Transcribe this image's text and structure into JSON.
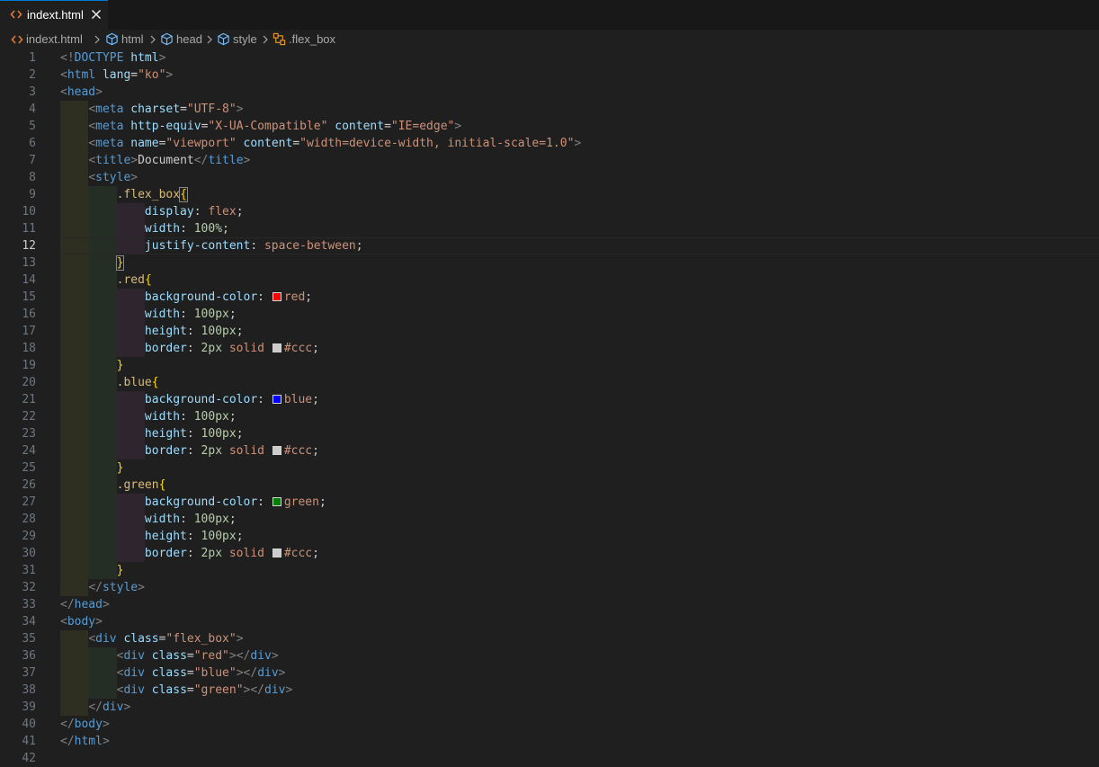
{
  "tab": {
    "label": "indext.html",
    "icon": "html-file-icon",
    "close_icon": "close-icon"
  },
  "breadcrumb": [
    {
      "label": "indext.html",
      "icon": "html-file-icon"
    },
    {
      "label": "html",
      "icon": "symbol-element-icon"
    },
    {
      "label": "head",
      "icon": "symbol-element-icon"
    },
    {
      "label": "style",
      "icon": "symbol-element-icon"
    },
    {
      "label": ".flex_box",
      "icon": "symbol-class-icon"
    }
  ],
  "editor": {
    "active_line": 12,
    "lines": [
      {
        "n": "1",
        "tokens": [
          [
            "t-br",
            "<!"
          ],
          [
            "t-doctype",
            "DOCTYPE"
          ],
          [
            "t-txt",
            " "
          ],
          [
            "t-kw",
            "html"
          ],
          [
            "t-br",
            ">"
          ]
        ]
      },
      {
        "n": "2",
        "tokens": [
          [
            "t-br",
            "<"
          ],
          [
            "t-tag",
            "html"
          ],
          [
            "t-txt",
            " "
          ],
          [
            "t-attr",
            "lang"
          ],
          [
            "t-txt",
            "="
          ],
          [
            "t-str",
            "\"ko\""
          ],
          [
            "t-br",
            ">"
          ]
        ]
      },
      {
        "n": "3",
        "tokens": [
          [
            "t-br",
            "<"
          ],
          [
            "t-tag",
            "head"
          ],
          [
            "t-br",
            ">"
          ]
        ]
      },
      {
        "n": "4",
        "tokens": [
          [
            "t-txt",
            "    "
          ],
          [
            "t-br",
            "<"
          ],
          [
            "t-tag",
            "meta"
          ],
          [
            "t-txt",
            " "
          ],
          [
            "t-attr",
            "charset"
          ],
          [
            "t-txt",
            "="
          ],
          [
            "t-str",
            "\"UTF-8\""
          ],
          [
            "t-br",
            ">"
          ]
        ]
      },
      {
        "n": "5",
        "tokens": [
          [
            "t-txt",
            "    "
          ],
          [
            "t-br",
            "<"
          ],
          [
            "t-tag",
            "meta"
          ],
          [
            "t-txt",
            " "
          ],
          [
            "t-attr",
            "http-equiv"
          ],
          [
            "t-txt",
            "="
          ],
          [
            "t-str",
            "\"X-UA-Compatible\""
          ],
          [
            "t-txt",
            " "
          ],
          [
            "t-attr",
            "content"
          ],
          [
            "t-txt",
            "="
          ],
          [
            "t-str",
            "\"IE=edge\""
          ],
          [
            "t-br",
            ">"
          ]
        ]
      },
      {
        "n": "6",
        "tokens": [
          [
            "t-txt",
            "    "
          ],
          [
            "t-br",
            "<"
          ],
          [
            "t-tag",
            "meta"
          ],
          [
            "t-txt",
            " "
          ],
          [
            "t-attr",
            "name"
          ],
          [
            "t-txt",
            "="
          ],
          [
            "t-str",
            "\"viewport\""
          ],
          [
            "t-txt",
            " "
          ],
          [
            "t-attr",
            "content"
          ],
          [
            "t-txt",
            "="
          ],
          [
            "t-str",
            "\"width=device-width, initial-scale=1.0\""
          ],
          [
            "t-br",
            ">"
          ]
        ]
      },
      {
        "n": "7",
        "tokens": [
          [
            "t-txt",
            "    "
          ],
          [
            "t-br",
            "<"
          ],
          [
            "t-tag",
            "title"
          ],
          [
            "t-br",
            ">"
          ],
          [
            "t-txt",
            "Document"
          ],
          [
            "t-br",
            "</"
          ],
          [
            "t-tag",
            "title"
          ],
          [
            "t-br",
            ">"
          ]
        ]
      },
      {
        "n": "8",
        "tokens": [
          [
            "t-txt",
            "    "
          ],
          [
            "t-br",
            "<"
          ],
          [
            "t-tag",
            "style"
          ],
          [
            "t-br",
            ">"
          ]
        ]
      },
      {
        "n": "9",
        "tokens": [
          [
            "t-txt",
            "        "
          ],
          [
            "t-sel",
            ".flex_box"
          ],
          [
            "t-brace brace-match",
            "{"
          ]
        ]
      },
      {
        "n": "10",
        "tokens": [
          [
            "t-txt",
            "            "
          ],
          [
            "t-prop",
            "display"
          ],
          [
            "t-punc",
            ": "
          ],
          [
            "t-val",
            "flex"
          ],
          [
            "t-punc",
            ";"
          ]
        ]
      },
      {
        "n": "11",
        "tokens": [
          [
            "t-txt",
            "            "
          ],
          [
            "t-prop",
            "width"
          ],
          [
            "t-punc",
            ": "
          ],
          [
            "t-num",
            "100%"
          ],
          [
            "t-punc",
            ";"
          ]
        ]
      },
      {
        "n": "12",
        "tokens": [
          [
            "t-txt",
            "            "
          ],
          [
            "t-prop",
            "justify-content"
          ],
          [
            "t-punc",
            ": "
          ],
          [
            "t-val",
            "space-between"
          ],
          [
            "t-punc",
            ";"
          ]
        ]
      },
      {
        "n": "13",
        "tokens": [
          [
            "t-txt",
            "        "
          ],
          [
            "t-brace brace-match",
            "}"
          ]
        ]
      },
      {
        "n": "14",
        "tokens": [
          [
            "t-txt",
            "        "
          ],
          [
            "t-sel",
            ".red"
          ],
          [
            "t-brace",
            "{"
          ]
        ]
      },
      {
        "n": "15",
        "tokens": [
          [
            "t-txt",
            "            "
          ],
          [
            "t-prop",
            "background-color"
          ],
          [
            "t-punc",
            ": "
          ],
          [
            "swatch",
            "#ff0000"
          ],
          [
            "t-val",
            "red"
          ],
          [
            "t-punc",
            ";"
          ]
        ]
      },
      {
        "n": "16",
        "tokens": [
          [
            "t-txt",
            "            "
          ],
          [
            "t-prop",
            "width"
          ],
          [
            "t-punc",
            ": "
          ],
          [
            "t-num",
            "100px"
          ],
          [
            "t-punc",
            ";"
          ]
        ]
      },
      {
        "n": "17",
        "tokens": [
          [
            "t-txt",
            "            "
          ],
          [
            "t-prop",
            "height"
          ],
          [
            "t-punc",
            ": "
          ],
          [
            "t-num",
            "100px"
          ],
          [
            "t-punc",
            ";"
          ]
        ]
      },
      {
        "n": "18",
        "tokens": [
          [
            "t-txt",
            "            "
          ],
          [
            "t-prop",
            "border"
          ],
          [
            "t-punc",
            ": "
          ],
          [
            "t-num",
            "2px"
          ],
          [
            "t-txt",
            " "
          ],
          [
            "t-val",
            "solid"
          ],
          [
            "t-txt",
            " "
          ],
          [
            "swatch",
            "#cccccc"
          ],
          [
            "t-val",
            "#ccc"
          ],
          [
            "t-punc",
            ";"
          ]
        ]
      },
      {
        "n": "19",
        "tokens": [
          [
            "t-txt",
            "        "
          ],
          [
            "t-brace",
            "}"
          ]
        ]
      },
      {
        "n": "20",
        "tokens": [
          [
            "t-txt",
            "        "
          ],
          [
            "t-sel",
            ".blue"
          ],
          [
            "t-brace",
            "{"
          ]
        ]
      },
      {
        "n": "21",
        "tokens": [
          [
            "t-txt",
            "            "
          ],
          [
            "t-prop",
            "background-color"
          ],
          [
            "t-punc",
            ": "
          ],
          [
            "swatch",
            "#0000ff"
          ],
          [
            "t-val",
            "blue"
          ],
          [
            "t-punc",
            ";"
          ]
        ]
      },
      {
        "n": "22",
        "tokens": [
          [
            "t-txt",
            "            "
          ],
          [
            "t-prop",
            "width"
          ],
          [
            "t-punc",
            ": "
          ],
          [
            "t-num",
            "100px"
          ],
          [
            "t-punc",
            ";"
          ]
        ]
      },
      {
        "n": "23",
        "tokens": [
          [
            "t-txt",
            "            "
          ],
          [
            "t-prop",
            "height"
          ],
          [
            "t-punc",
            ": "
          ],
          [
            "t-num",
            "100px"
          ],
          [
            "t-punc",
            ";"
          ]
        ]
      },
      {
        "n": "24",
        "tokens": [
          [
            "t-txt",
            "            "
          ],
          [
            "t-prop",
            "border"
          ],
          [
            "t-punc",
            ": "
          ],
          [
            "t-num",
            "2px"
          ],
          [
            "t-txt",
            " "
          ],
          [
            "t-val",
            "solid"
          ],
          [
            "t-txt",
            " "
          ],
          [
            "swatch",
            "#cccccc"
          ],
          [
            "t-val",
            "#ccc"
          ],
          [
            "t-punc",
            ";"
          ]
        ]
      },
      {
        "n": "25",
        "tokens": [
          [
            "t-txt",
            "        "
          ],
          [
            "t-brace",
            "}"
          ]
        ]
      },
      {
        "n": "26",
        "tokens": [
          [
            "t-txt",
            "        "
          ],
          [
            "t-sel",
            ".green"
          ],
          [
            "t-brace",
            "{"
          ]
        ]
      },
      {
        "n": "27",
        "tokens": [
          [
            "t-txt",
            "            "
          ],
          [
            "t-prop",
            "background-color"
          ],
          [
            "t-punc",
            ": "
          ],
          [
            "swatch",
            "#008000"
          ],
          [
            "t-val",
            "green"
          ],
          [
            "t-punc",
            ";"
          ]
        ]
      },
      {
        "n": "28",
        "tokens": [
          [
            "t-txt",
            "            "
          ],
          [
            "t-prop",
            "width"
          ],
          [
            "t-punc",
            ": "
          ],
          [
            "t-num",
            "100px"
          ],
          [
            "t-punc",
            ";"
          ]
        ]
      },
      {
        "n": "29",
        "tokens": [
          [
            "t-txt",
            "            "
          ],
          [
            "t-prop",
            "height"
          ],
          [
            "t-punc",
            ": "
          ],
          [
            "t-num",
            "100px"
          ],
          [
            "t-punc",
            ";"
          ]
        ]
      },
      {
        "n": "30",
        "tokens": [
          [
            "t-txt",
            "            "
          ],
          [
            "t-prop",
            "border"
          ],
          [
            "t-punc",
            ": "
          ],
          [
            "t-num",
            "2px"
          ],
          [
            "t-txt",
            " "
          ],
          [
            "t-val",
            "solid"
          ],
          [
            "t-txt",
            " "
          ],
          [
            "swatch",
            "#cccccc"
          ],
          [
            "t-val",
            "#ccc"
          ],
          [
            "t-punc",
            ";"
          ]
        ]
      },
      {
        "n": "31",
        "tokens": [
          [
            "t-txt",
            "        "
          ],
          [
            "t-brace",
            "}"
          ]
        ]
      },
      {
        "n": "32",
        "tokens": [
          [
            "t-txt",
            "    "
          ],
          [
            "t-br",
            "</"
          ],
          [
            "t-tag",
            "style"
          ],
          [
            "t-br",
            ">"
          ]
        ]
      },
      {
        "n": "33",
        "tokens": [
          [
            "t-br",
            "</"
          ],
          [
            "t-tag",
            "head"
          ],
          [
            "t-br",
            ">"
          ]
        ]
      },
      {
        "n": "34",
        "tokens": [
          [
            "t-br",
            "<"
          ],
          [
            "t-tag",
            "body"
          ],
          [
            "t-br",
            ">"
          ]
        ]
      },
      {
        "n": "35",
        "tokens": [
          [
            "t-txt",
            "    "
          ],
          [
            "t-br",
            "<"
          ],
          [
            "t-tag",
            "div"
          ],
          [
            "t-txt",
            " "
          ],
          [
            "t-attr",
            "class"
          ],
          [
            "t-txt",
            "="
          ],
          [
            "t-str",
            "\"flex_box\""
          ],
          [
            "t-br",
            ">"
          ]
        ]
      },
      {
        "n": "36",
        "tokens": [
          [
            "t-txt",
            "        "
          ],
          [
            "t-br",
            "<"
          ],
          [
            "t-tag",
            "div"
          ],
          [
            "t-txt",
            " "
          ],
          [
            "t-attr",
            "class"
          ],
          [
            "t-txt",
            "="
          ],
          [
            "t-str",
            "\"red\""
          ],
          [
            "t-br",
            "></"
          ],
          [
            "t-tag",
            "div"
          ],
          [
            "t-br",
            ">"
          ]
        ]
      },
      {
        "n": "37",
        "tokens": [
          [
            "t-txt",
            "        "
          ],
          [
            "t-br",
            "<"
          ],
          [
            "t-tag",
            "div"
          ],
          [
            "t-txt",
            " "
          ],
          [
            "t-attr",
            "class"
          ],
          [
            "t-txt",
            "="
          ],
          [
            "t-str",
            "\"blue\""
          ],
          [
            "t-br",
            "></"
          ],
          [
            "t-tag",
            "div"
          ],
          [
            "t-br",
            ">"
          ]
        ]
      },
      {
        "n": "38",
        "tokens": [
          [
            "t-txt",
            "        "
          ],
          [
            "t-br",
            "<"
          ],
          [
            "t-tag",
            "div"
          ],
          [
            "t-txt",
            " "
          ],
          [
            "t-attr",
            "class"
          ],
          [
            "t-txt",
            "="
          ],
          [
            "t-str",
            "\"green\""
          ],
          [
            "t-br",
            "></"
          ],
          [
            "t-tag",
            "div"
          ],
          [
            "t-br",
            ">"
          ]
        ]
      },
      {
        "n": "39",
        "tokens": [
          [
            "t-txt",
            "    "
          ],
          [
            "t-br",
            "</"
          ],
          [
            "t-tag",
            "div"
          ],
          [
            "t-br",
            ">"
          ]
        ]
      },
      {
        "n": "40",
        "tokens": [
          [
            "t-br",
            "</"
          ],
          [
            "t-tag",
            "body"
          ],
          [
            "t-br",
            ">"
          ]
        ]
      },
      {
        "n": "41",
        "tokens": [
          [
            "t-br",
            "</"
          ],
          [
            "t-tag",
            "html"
          ],
          [
            "t-br",
            ">"
          ]
        ]
      },
      {
        "n": "42",
        "tokens": []
      }
    ]
  },
  "colors": {
    "editor_bg": "#1f1f1f",
    "tab_accent": "#0078d4",
    "html_icon": "#e37933",
    "symbol_icon": "#75beff",
    "class_icon": "#ee9d28"
  }
}
